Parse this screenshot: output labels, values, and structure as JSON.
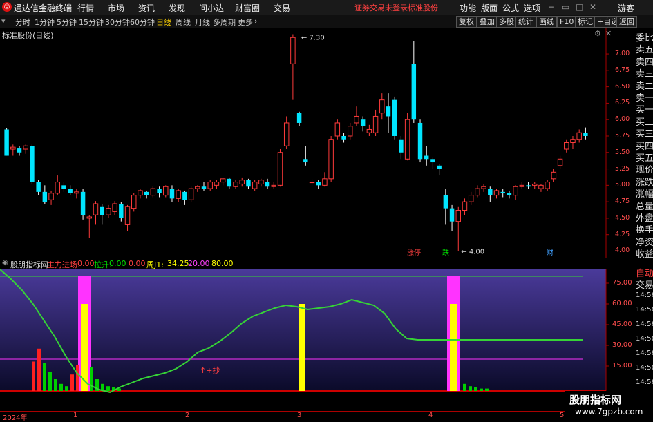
{
  "menubar": {
    "app_title": "通达信金融终端",
    "items": [
      "行情",
      "市场",
      "资讯",
      "发现",
      "问小达",
      "财富圈",
      "交易"
    ],
    "warning": "证券交易未登录",
    "stock_name": "标准股份",
    "right_items": [
      "功能",
      "版面",
      "公式",
      "选项"
    ],
    "guest": "游客"
  },
  "periods": {
    "items": [
      "分时",
      "1分钟",
      "5分钟",
      "15分钟",
      "30分钟",
      "60分钟",
      "日线",
      "周线",
      "月线",
      "多周期",
      "更多"
    ],
    "active_index": 6
  },
  "toolbar": [
    "复权",
    "叠加",
    "多股",
    "统计",
    "画线",
    "F10",
    "标记",
    "+自选",
    "返回"
  ],
  "chart": {
    "title": "标准股份(日线)",
    "high_label": "7.30",
    "low_label": "4.00",
    "price_ticks": [
      "7.00",
      "6.75",
      "6.50",
      "6.25",
      "6.00",
      "5.75",
      "5.50",
      "5.25",
      "5.00",
      "4.75",
      "4.50",
      "4.25",
      "4.00"
    ],
    "markers": [
      {
        "text": "涨停",
        "color": "#ff4040"
      },
      {
        "text": "跌",
        "color": "#00e000"
      },
      {
        "text": "财",
        "color": "#40a0ff"
      }
    ]
  },
  "indicator": {
    "name": "股朋指标网",
    "fields": [
      {
        "label": "主力进场:",
        "value": "0.00",
        "color": "#ff4040"
      },
      {
        "label": "拉升:",
        "value": "0.00",
        "color": "#00e000"
      },
      {
        "label": "",
        "value": "0.00",
        "color": "#ff4040"
      },
      {
        "label": "周J1:",
        "value": "34.25",
        "color": "#ffff00"
      },
      {
        "label": "",
        "value": "20.00",
        "color": "#ff40ff"
      },
      {
        "label": "",
        "value": "80.00",
        "color": "#ffff00"
      }
    ],
    "ticks": [
      "75.00",
      "60.00",
      "45.00",
      "30.00",
      "15.00"
    ],
    "annotation": "↑+抄"
  },
  "x_axis": [
    "2024年",
    "1",
    "2",
    "3",
    "4",
    "5"
  ],
  "side_panel": {
    "labels": [
      "委比",
      "卖五",
      "卖四",
      "卖三",
      "卖二",
      "卖一",
      "买一",
      "买二",
      "买三",
      "买四",
      "买五",
      "现价",
      "涨跌",
      "涨幅",
      "总量",
      "外盘",
      "换手",
      "净资",
      "收益"
    ],
    "bottom_labels": [
      "自动",
      "交易"
    ],
    "times": [
      "14:56",
      "14:56",
      "14:56",
      "14:56",
      "14:56",
      "14:56",
      "14:56",
      "14:56",
      "14:56"
    ]
  },
  "watermark": {
    "line1": "股朋指标网",
    "line2": "www.7gpzb.com"
  },
  "colors": {
    "up": "#ff3b3b",
    "down": "#00e5ff",
    "line": "#36d336",
    "magenta": "#ff33ff",
    "yellow": "#ffff00"
  },
  "chart_data": {
    "type": "candlestick",
    "ylim": [
      3.9,
      7.4
    ],
    "candles": [
      [
        5.85,
        5.45,
        5.87,
        5.45
      ],
      [
        5.55,
        5.58,
        5.62,
        5.45
      ],
      [
        5.56,
        5.5,
        5.6,
        5.45
      ],
      [
        5.55,
        5.6,
        5.62,
        5.48
      ],
      [
        5.6,
        5.05,
        5.62,
        5.02
      ],
      [
        5.05,
        4.9,
        5.08,
        4.85
      ],
      [
        4.9,
        4.75,
        5.0,
        4.72
      ],
      [
        4.78,
        4.88,
        4.92,
        4.7
      ],
      [
        4.88,
        5.05,
        5.15,
        4.85
      ],
      [
        5.0,
        4.95,
        5.05,
        4.9
      ],
      [
        4.95,
        4.88,
        5.0,
        4.85
      ],
      [
        4.88,
        4.9,
        4.95,
        4.8
      ],
      [
        4.9,
        4.55,
        4.95,
        4.48
      ],
      [
        4.5,
        4.52,
        4.55,
        4.2
      ],
      [
        4.55,
        4.72,
        4.76,
        4.4
      ],
      [
        4.68,
        4.55,
        4.72,
        4.4
      ],
      [
        4.55,
        4.65,
        4.7,
        4.5
      ],
      [
        4.6,
        4.72,
        4.76,
        4.55
      ],
      [
        4.72,
        4.5,
        4.75,
        4.45
      ],
      [
        4.4,
        4.68,
        4.7,
        4.3
      ],
      [
        4.65,
        4.85,
        4.88,
        4.6
      ],
      [
        4.85,
        4.92,
        4.95,
        4.8
      ],
      [
        4.9,
        4.85,
        4.92,
        4.8
      ],
      [
        4.85,
        4.95,
        4.98,
        4.82
      ],
      [
        4.95,
        4.88,
        4.98,
        4.82
      ],
      [
        4.85,
        4.98,
        5.0,
        4.82
      ],
      [
        4.95,
        4.8,
        5.0,
        4.75
      ],
      [
        4.8,
        4.92,
        4.95,
        4.75
      ],
      [
        4.9,
        4.78,
        4.92,
        4.7
      ],
      [
        4.78,
        4.95,
        4.98,
        4.75
      ],
      [
        4.95,
        4.98,
        5.0,
        4.9
      ],
      [
        4.98,
        4.95,
        5.05,
        4.92
      ],
      [
        4.95,
        5.05,
        5.08,
        4.92
      ],
      [
        5.0,
        5.05,
        5.08,
        4.95
      ],
      [
        5.05,
        5.1,
        5.12,
        5.0
      ],
      [
        5.1,
        4.98,
        5.12,
        4.95
      ],
      [
        4.98,
        5.05,
        5.08,
        4.95
      ],
      [
        5.02,
        5.08,
        5.12,
        4.98
      ],
      [
        5.08,
        4.98,
        5.1,
        4.95
      ],
      [
        4.95,
        5.05,
        5.08,
        4.92
      ],
      [
        5.02,
        5.08,
        5.1,
        4.98
      ],
      [
        5.05,
        4.98,
        5.1,
        4.95
      ],
      [
        4.98,
        5.0,
        5.05,
        4.95
      ],
      [
        5.0,
        5.5,
        5.55,
        4.98
      ],
      [
        5.6,
        5.95,
        6.05,
        5.55
      ],
      [
        6.85,
        7.25,
        7.3,
        6.3
      ],
      [
        6.1,
        5.95,
        6.12,
        5.9
      ],
      [
        5.4,
        5.35,
        5.6,
        5.3
      ],
      [
        5.05,
        5.05,
        5.1,
        4.98
      ],
      [
        5.05,
        5.0,
        5.08,
        4.95
      ],
      [
        5.0,
        5.1,
        5.2,
        4.98
      ],
      [
        5.1,
        5.7,
        5.75,
        5.05
      ],
      [
        5.75,
        5.95,
        6.0,
        5.7
      ],
      [
        5.75,
        5.7,
        5.8,
        5.65
      ],
      [
        5.75,
        5.9,
        5.95,
        5.7
      ],
      [
        5.95,
        6.05,
        6.2,
        5.9
      ],
      [
        6.0,
        5.9,
        6.05,
        5.82
      ],
      [
        5.8,
        5.85,
        5.92,
        5.75
      ],
      [
        5.8,
        6.05,
        6.15,
        5.75
      ],
      [
        6.1,
        6.3,
        6.4,
        6.0
      ],
      [
        6.2,
        6.05,
        6.4,
        5.8
      ],
      [
        6.3,
        5.75,
        6.35,
        5.7
      ],
      [
        5.7,
        5.5,
        5.75,
        5.4
      ],
      [
        5.4,
        6.0,
        6.1,
        5.38
      ],
      [
        6.85,
        6.0,
        7.2,
        5.95
      ],
      [
        5.95,
        5.4,
        6.0,
        5.35
      ],
      [
        5.45,
        5.4,
        5.6,
        5.3
      ],
      [
        5.4,
        5.35,
        5.42,
        5.25
      ],
      [
        5.3,
        5.25,
        5.32,
        5.15
      ],
      [
        4.85,
        4.65,
        4.95,
        4.4
      ],
      [
        4.65,
        4.45,
        4.7,
        4.3
      ],
      [
        4.45,
        4.62,
        4.68,
        4.0
      ],
      [
        4.62,
        4.75,
        4.8,
        4.55
      ],
      [
        4.75,
        4.85,
        4.9,
        4.7
      ],
      [
        4.85,
        4.95,
        5.0,
        4.82
      ],
      [
        4.95,
        4.98,
        5.02,
        4.9
      ],
      [
        4.95,
        4.85,
        4.98,
        4.75
      ],
      [
        4.85,
        4.92,
        4.95,
        4.8
      ],
      [
        4.9,
        4.88,
        4.95,
        4.82
      ],
      [
        4.88,
        4.85,
        4.92,
        4.8
      ],
      [
        4.85,
        4.98,
        5.0,
        4.78
      ],
      [
        4.98,
        5.0,
        5.05,
        4.95
      ],
      [
        5.0,
        4.98,
        5.05,
        4.95
      ],
      [
        5.0,
        5.02,
        5.05,
        4.95
      ],
      [
        4.95,
        5.0,
        5.02,
        4.9
      ],
      [
        4.95,
        5.05,
        5.08,
        4.92
      ],
      [
        5.1,
        5.2,
        5.25,
        5.05
      ],
      [
        5.3,
        5.4,
        5.45,
        5.25
      ],
      [
        5.55,
        5.65,
        5.7,
        5.5
      ],
      [
        5.65,
        5.7,
        5.75,
        5.55
      ],
      [
        5.7,
        5.8,
        5.85,
        5.65
      ],
      [
        5.8,
        5.75,
        5.88,
        5.7
      ]
    ],
    "indicator": {
      "ylim": [
        -4,
        85
      ],
      "line": [
        85,
        78,
        70,
        60,
        48,
        36,
        22,
        10,
        2,
        -2,
        -4,
        0,
        3,
        6,
        8,
        10,
        13,
        18,
        25,
        28,
        33,
        39,
        46,
        51,
        54,
        57,
        59,
        58,
        56,
        57,
        58,
        60,
        63,
        61,
        59,
        53,
        42,
        35,
        34,
        34,
        34,
        34,
        34,
        34,
        34,
        34,
        34,
        34,
        34,
        34,
        34,
        34,
        34,
        34
      ],
      "ref_low": 20,
      "ref_high": 80,
      "yellow_bars": [
        60,
        60,
        60
      ],
      "magenta_bars": [
        80,
        80
      ]
    }
  }
}
